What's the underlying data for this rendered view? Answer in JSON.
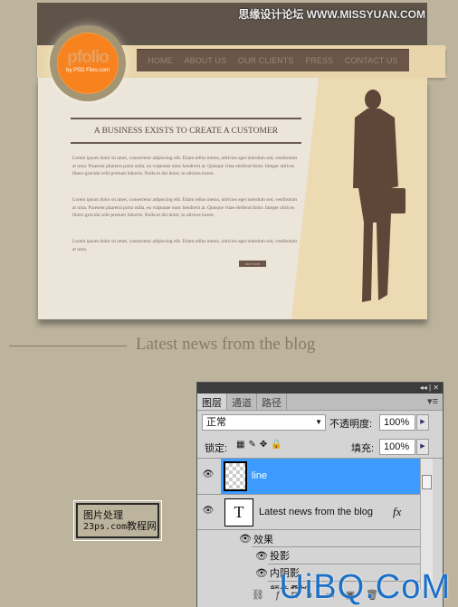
{
  "header": {
    "watermark_top": "思缘设计论坛  WWW.MISSYUAN.COM"
  },
  "logo": {
    "name": "pfolio",
    "tagline": "by PSD Files.com"
  },
  "nav": [
    "HOME",
    "ABOUT US",
    "OUR CLIENTS",
    "PRESS",
    "CONTACT US"
  ],
  "content": {
    "headline": "A BUSINESS EXISTS TO CREATE A CUSTOMER",
    "paragraphs": [
      "Lorem ipsum dolor sit amet, consectetur adipiscing elit. Etiam tellus metus, ultricies eget interdum sed, vestibulum at urna. Praesent pharetra porta nulla, eu vulputate nunc hendrerit at. Quisque vitae eleifend dolor. Integer ultrices libero gravida velit pretium lobortis. Nulla et dui dolor, in ultrices lorem.",
      "Lorem ipsum dolor sit amet, consectetur adipiscing elit. Etiam tellus metus, ultricies eget interdum sed, vestibulum at urna. Praesent pharetra porta nulla, eu vulputate nunc hendrerit at. Quisque vitae eleifend dolor. Integer ultrices libero gravida velit pretium lobortis. Nulla et dui dolor, in ultrices lorem.",
      "Lorem ipsum dolor sit amet, consectetur adipiscing elit. Etiam tellus metus, ultricies eget interdum sed, vestibulum at urna."
    ],
    "more": "see more"
  },
  "blog_title": "Latest news from the blog",
  "stamp": {
    "line1": "图片处理",
    "line2": "23ps.com",
    "line3": "教程网"
  },
  "panel": {
    "tabs": [
      "图层",
      "通道",
      "路径"
    ],
    "blend_mode": "正常",
    "opacity_label": "不透明度:",
    "opacity": "100%",
    "lock_label": "锁定:",
    "fill_label": "填充:",
    "fill": "100%",
    "layers": [
      {
        "name": "line",
        "selected": true
      },
      {
        "name": "Latest news from the blog",
        "thumb": "T",
        "fx": "fx"
      }
    ],
    "effects_label": "效果",
    "effects": [
      "投影",
      "内阴影",
      "颜色叠加"
    ]
  },
  "watermark_bottom": "UiBQ.CoM",
  "colors": {
    "selection": "#3d9bff",
    "accent": "#f7821e",
    "nav": "#6b5548"
  }
}
